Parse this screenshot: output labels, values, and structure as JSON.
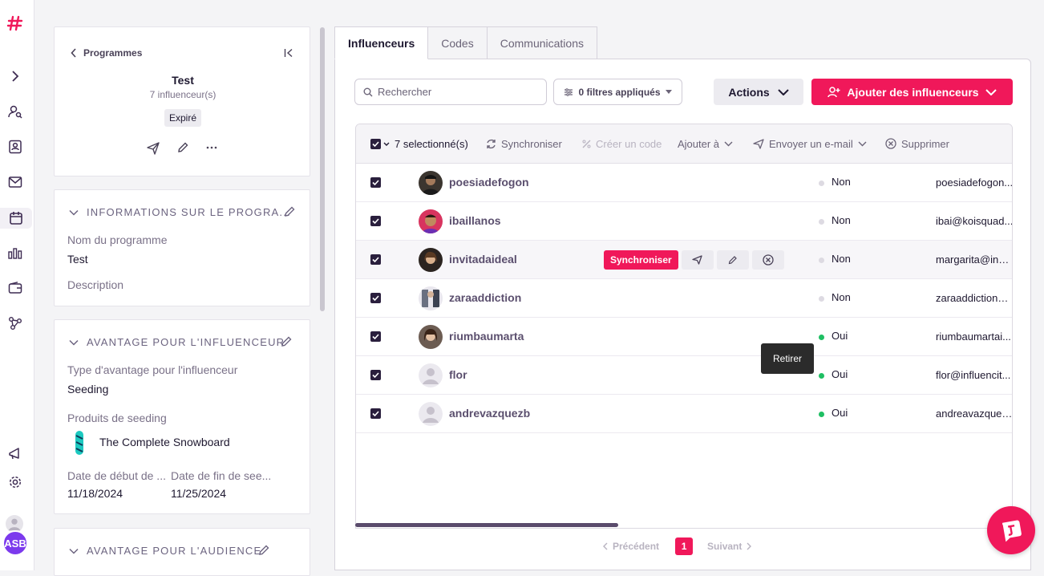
{
  "colors": {
    "accent": "#f0185a",
    "dark": "#2a1f3d",
    "green": "#1fbf63",
    "grey_dot": "#dddae2"
  },
  "sidebar": {
    "avatar_initials": "ASB"
  },
  "program": {
    "back_label": "Programmes",
    "name": "Test",
    "count": "7 influenceur(s)",
    "status": "Expiré"
  },
  "info_section": {
    "title": "INFORMATIONS SUR LE PROGRA...",
    "name_label": "Nom du programme",
    "name_value": "Test",
    "description_label": "Description"
  },
  "advantage_section": {
    "title": "AVANTAGE POUR L'INFLUENCEUR",
    "type_label": "Type d'avantage pour l'influenceur",
    "type_value": "Seeding",
    "products_label": "Produits de seeding",
    "product_name": "The Complete Snowboard",
    "start_label": "Date de début de ...",
    "end_label": "Date de fin de see...",
    "start_value": "11/18/2024",
    "end_value": "11/25/2024"
  },
  "audience_section": {
    "title": "AVANTAGE POUR L'AUDIENCE"
  },
  "tabs": [
    "Influenceurs",
    "Codes",
    "Communications"
  ],
  "toolbar": {
    "search_placeholder": "Rechercher",
    "filters_label": "0 filtres appliqués",
    "actions_label": "Actions",
    "add_label": "Ajouter des influenceurs"
  },
  "bulk": {
    "selected": "7 selectionné(s)",
    "sync": "Synchroniser",
    "create_code": "Créer un code",
    "add_to": "Ajouter à",
    "send_email": "Envoyer un e-mail",
    "delete": "Supprimer"
  },
  "rows": [
    {
      "name": "poesiadefogon",
      "status": "Non",
      "email": "poesiadefogon..."
    },
    {
      "name": "ibaillanos",
      "status": "Non",
      "email": "ibai@koisquad..."
    },
    {
      "name": "invitadaideal",
      "status": "Non",
      "email": "margarita@invi..."
    },
    {
      "name": "zaraaddiction",
      "status": "Non",
      "email": "zaraaddiction@..."
    },
    {
      "name": "riumbaumarta",
      "status": "Oui",
      "email": "riumbaumartai..."
    },
    {
      "name": "flor",
      "status": "Oui",
      "email": "flor@influencit..."
    },
    {
      "name": "andrevazquezb",
      "status": "Oui",
      "email": "andreavazquez..."
    }
  ],
  "row_actions": {
    "sync_label": "Synchroniser",
    "tooltip": "Retirer"
  },
  "pagination": {
    "prev": "Précédent",
    "page": "1",
    "next": "Suivant"
  }
}
